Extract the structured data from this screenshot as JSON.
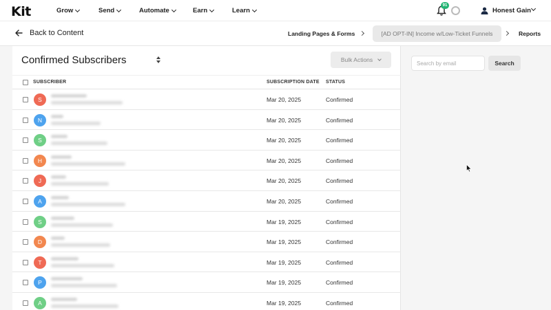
{
  "app": {
    "logo": "Kit"
  },
  "topnav": {
    "items": [
      "Grow",
      "Send",
      "Automate",
      "Earn",
      "Learn"
    ],
    "notification_count": "91",
    "user_name": "Honest Gain"
  },
  "breadcrumb": {
    "back_label": "Back to Content",
    "crumb1": "Landing Pages & Forms",
    "crumb2": "[AD OPT-IN] Income w/Low-Ticket Funnels",
    "crumb3": "Reports"
  },
  "panel": {
    "title": "Confirmed Subscribers",
    "bulk_actions_label": "Bulk Actions",
    "columns": {
      "subscriber": "SUBSCRIBER",
      "date": "SUBSCRIPTION DATE",
      "status": "STATUS"
    }
  },
  "rows": [
    {
      "initial": "S",
      "color": "#ef6a55",
      "date": "Mar 20, 2025",
      "status": "Confirmed"
    },
    {
      "initial": "N",
      "color": "#4ea3ee",
      "date": "Mar 20, 2025",
      "status": "Confirmed"
    },
    {
      "initial": "S",
      "color": "#6fcf86",
      "date": "Mar 20, 2025",
      "status": "Confirmed"
    },
    {
      "initial": "H",
      "color": "#f2874f",
      "date": "Mar 20, 2025",
      "status": "Confirmed"
    },
    {
      "initial": "J",
      "color": "#ef6a55",
      "date": "Mar 20, 2025",
      "status": "Confirmed"
    },
    {
      "initial": "A",
      "color": "#4ea3ee",
      "date": "Mar 20, 2025",
      "status": "Confirmed"
    },
    {
      "initial": "S",
      "color": "#6fcf86",
      "date": "Mar 19, 2025",
      "status": "Confirmed"
    },
    {
      "initial": "D",
      "color": "#f2874f",
      "date": "Mar 19, 2025",
      "status": "Confirmed"
    },
    {
      "initial": "T",
      "color": "#ef6a55",
      "date": "Mar 19, 2025",
      "status": "Confirmed"
    },
    {
      "initial": "P",
      "color": "#4ea3ee",
      "date": "Mar 19, 2025",
      "status": "Confirmed"
    },
    {
      "initial": "A",
      "color": "#6fcf86",
      "date": "Mar 19, 2025",
      "status": "Confirmed"
    }
  ],
  "search": {
    "placeholder": "Search by email",
    "button_label": "Search"
  },
  "icons": {
    "bell": "bell-icon",
    "back": "arrow-left-icon",
    "user": "user-icon",
    "sort": "sort-icon",
    "chevron": "chevron-down-icon",
    "cursor": "mouse-pointer-icon"
  }
}
